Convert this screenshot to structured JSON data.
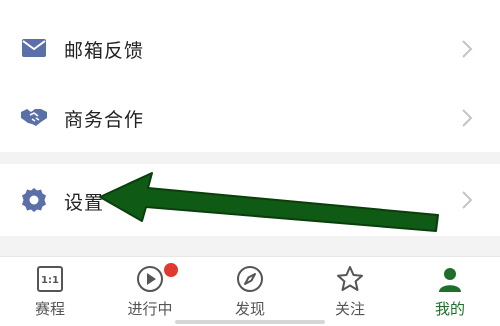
{
  "menu": {
    "mail_feedback": "邮箱反馈",
    "business": "商务合作",
    "settings": "设置"
  },
  "tabs": [
    {
      "label": "赛程",
      "icon": "schedule-1-1-icon"
    },
    {
      "label": "进行中",
      "icon": "play-live-icon"
    },
    {
      "label": "发现",
      "icon": "compass-icon"
    },
    {
      "label": "关注",
      "icon": "star-icon"
    },
    {
      "label": "我的",
      "icon": "profile-icon"
    }
  ],
  "schedule_icon_text": "1:1",
  "colors": {
    "accent_green": "#1f6f2b",
    "icon_blue": "#5b6fa8",
    "badge_red": "#e03a2e",
    "arrow_green": "#0f5a14"
  }
}
